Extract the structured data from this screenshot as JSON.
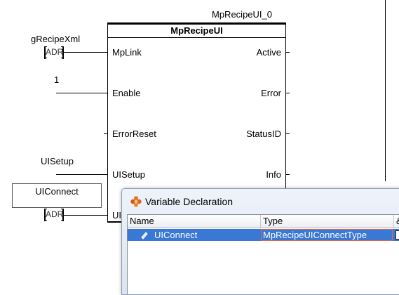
{
  "block": {
    "instance_name": "MpRecipeUI_0",
    "type_name": "MpRecipeUI",
    "inputs": [
      "MpLink",
      "Enable",
      "ErrorReset",
      "UISetup",
      "UI"
    ],
    "outputs": [
      "Active",
      "Error",
      "StatusID",
      "Info"
    ]
  },
  "connections": {
    "mplink_var": "gRecipeXml",
    "mplink_adr": "ADR",
    "enable_value": "1",
    "uisetup_var": "UISetup",
    "uiconnect_var": "UIConnect",
    "uiconnect_adr": "ADR"
  },
  "dialog": {
    "title": "Variable Declaration",
    "icon": "flower-icon",
    "columns": [
      "Name",
      "Type",
      "&"
    ],
    "row": {
      "name": "UIConnect",
      "type": "MpRecipeUIConnectType",
      "icon": "variable-icon"
    }
  },
  "colors": {
    "selection": "#3a78d6",
    "dialog_border": "#8a9bb3"
  }
}
